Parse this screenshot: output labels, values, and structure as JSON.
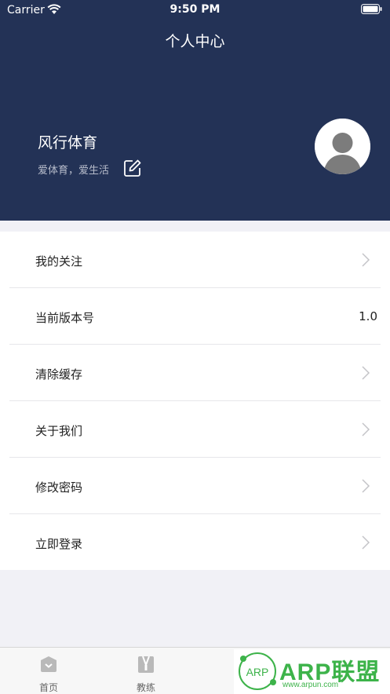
{
  "status_bar": {
    "carrier": "Carrier",
    "time": "9:50 PM"
  },
  "nav": {
    "title": "个人中心"
  },
  "profile": {
    "name": "风行体育",
    "subtitle": "爱体育，爱生活"
  },
  "menu": {
    "items": [
      {
        "label": "我的关注",
        "value": "",
        "chevron": true
      },
      {
        "label": "当前版本号",
        "value": "1.0",
        "chevron": false
      },
      {
        "label": "清除缓存",
        "value": "",
        "chevron": true
      },
      {
        "label": "关于我们",
        "value": "",
        "chevron": true
      },
      {
        "label": "修改密码",
        "value": "",
        "chevron": true
      },
      {
        "label": "立即登录",
        "value": "",
        "chevron": true
      }
    ]
  },
  "tabs": [
    {
      "label": "首页",
      "icon": "home-icon"
    },
    {
      "label": "教练",
      "icon": "coach-icon"
    }
  ],
  "watermark": {
    "text": "ARP联盟",
    "logo": "ARP",
    "url": "www.arpun.com"
  },
  "colors": {
    "header": "#233256",
    "accent": "#3db34a"
  }
}
